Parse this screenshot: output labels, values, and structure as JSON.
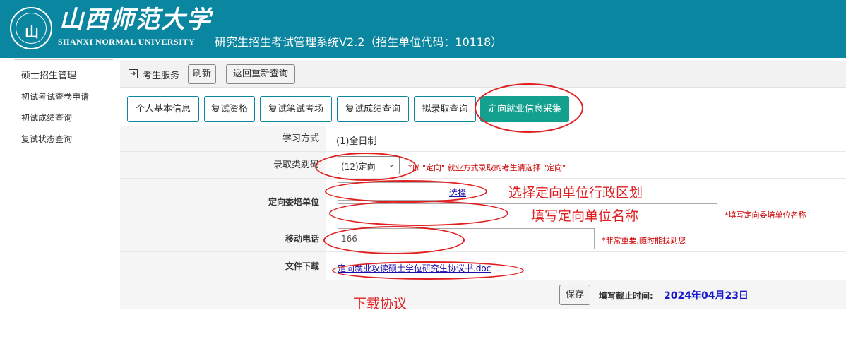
{
  "header": {
    "emblem_text": "山",
    "logo_cn": "山西师范大学",
    "logo_en": "SHANXI NORMAL UNIVERSITY",
    "system_title": "研究生招生考试管理系统V2.2（招生单位代码：10118）"
  },
  "sidebar": {
    "items": [
      {
        "label": "硕士招生管理"
      },
      {
        "label": "初试考试查卷申请"
      },
      {
        "label": "初试成绩查询"
      },
      {
        "label": "复试状态查询"
      }
    ]
  },
  "toolbar": {
    "section_label": "考生服务",
    "refresh_label": "刷新",
    "back_label": "返回重新查询"
  },
  "tabs": [
    {
      "label": "个人基本信息",
      "active": false
    },
    {
      "label": "复试资格",
      "active": false
    },
    {
      "label": "复试笔试考场",
      "active": false
    },
    {
      "label": "复试成绩查询",
      "active": false
    },
    {
      "label": "拟录取查询",
      "active": false
    },
    {
      "label": "定向就业信息采集",
      "active": true
    }
  ],
  "form": {
    "study_mode": {
      "label": "学习方式",
      "value": "(1)全日制"
    },
    "admission_category": {
      "label": "录取类别码",
      "selected": "(12)定向",
      "hint": "*以 \"定向\" 就业方式录取的考生请选择 \"定向\""
    },
    "employer": {
      "label": "定向委培单位",
      "region_value": "",
      "select_link": "选择",
      "name_value": "",
      "name_hint": "*填写定向委培单位名称"
    },
    "mobile": {
      "label": "移动电话",
      "value": "166",
      "hint": "*非常重要,随时能找到您"
    },
    "download": {
      "label": "文件下载",
      "link": "定向就业攻读硕士学位研究生协议书.doc"
    },
    "save_label": "保存",
    "deadline_label": "填写截止时间:",
    "deadline_value": "2024年04月23日"
  },
  "annotations": {
    "region_note": "选择定向单位行政区划",
    "name_note": "填写定向单位名称",
    "download_note": "下载协议"
  },
  "colors": {
    "header_bg": "#0b86a0",
    "active_tab": "#14a08f",
    "annotation": "#e02020",
    "hint": "#c00000",
    "deadline": "#1a1acc"
  }
}
